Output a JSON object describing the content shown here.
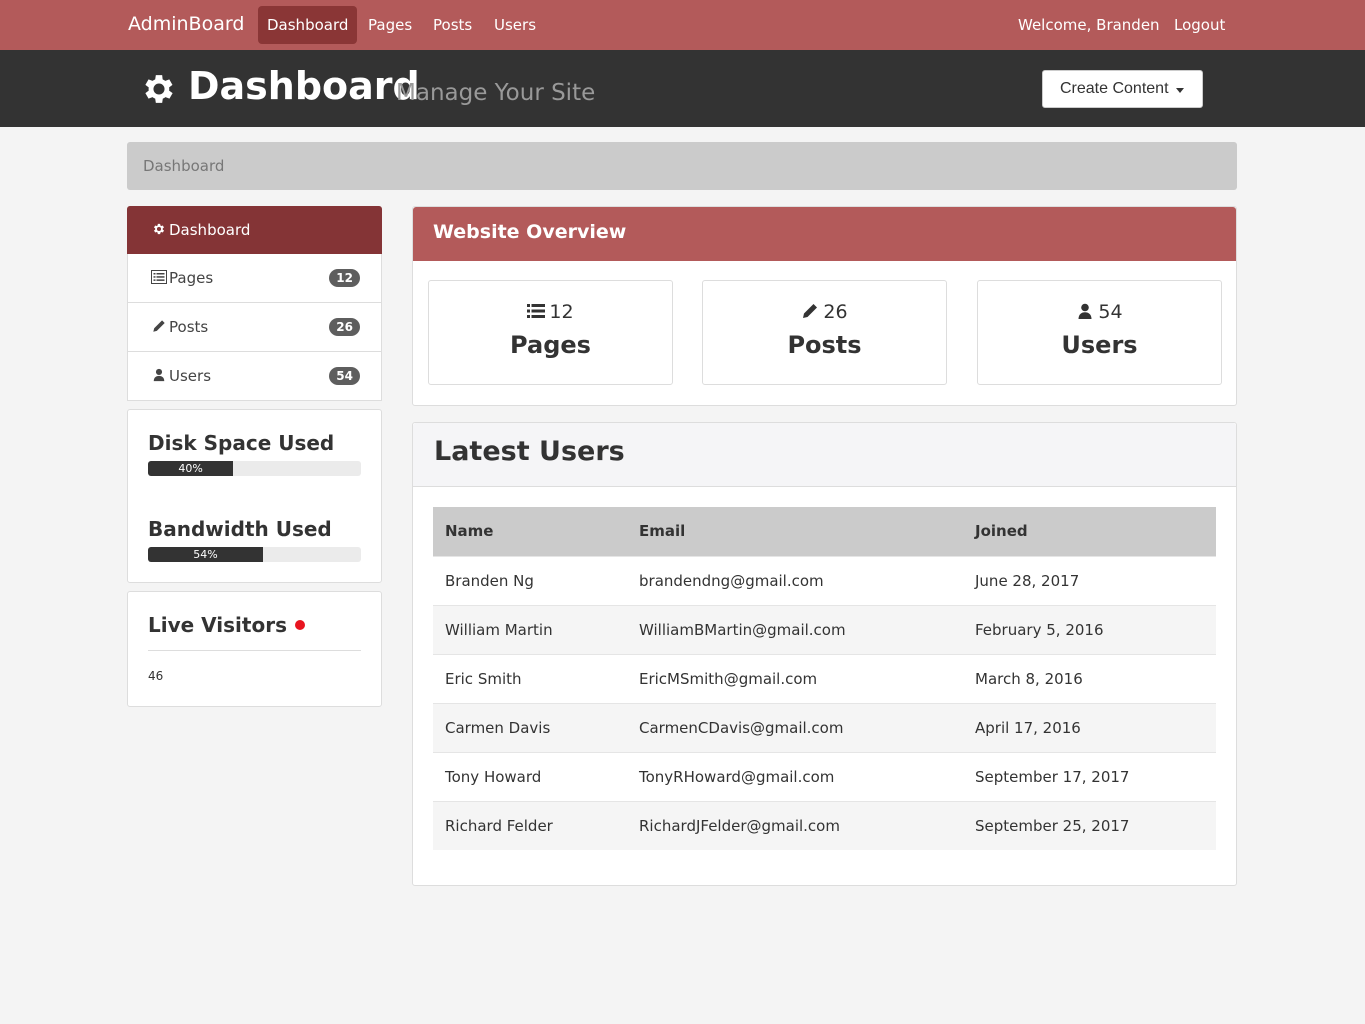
{
  "navbar": {
    "brand": "AdminBoard",
    "links": [
      "Dashboard",
      "Pages",
      "Posts",
      "Users"
    ],
    "welcome": "Welcome, Branden",
    "logout": "Logout"
  },
  "header": {
    "title": "Dashboard",
    "subtitle": "Manage Your Site",
    "create_button": "Create Content"
  },
  "breadcrumb": "Dashboard",
  "sidebar": {
    "items": [
      {
        "label": "Dashboard",
        "icon": "gear-icon"
      },
      {
        "label": "Pages",
        "icon": "list-icon",
        "count": "12"
      },
      {
        "label": "Posts",
        "icon": "pencil-icon",
        "count": "26"
      },
      {
        "label": "Users",
        "icon": "user-icon",
        "count": "54"
      }
    ],
    "disk": {
      "title": "Disk Space Used",
      "percent_label": "40%",
      "value": 0.4
    },
    "bandwidth": {
      "title": "Bandwidth Used",
      "percent_label": "54%",
      "value": 0.54
    },
    "live": {
      "title": "Live Visitors",
      "count": "46"
    }
  },
  "overview": {
    "title": "Website Overview",
    "stats": [
      {
        "number": "12",
        "label": "Pages",
        "icon": "list-icon"
      },
      {
        "number": "26",
        "label": "Posts",
        "icon": "pencil-icon"
      },
      {
        "number": "54",
        "label": "Users",
        "icon": "user-icon"
      }
    ]
  },
  "latest": {
    "title": "Latest Users",
    "columns": [
      "Name",
      "Email",
      "Joined"
    ],
    "rows": [
      [
        "Branden Ng",
        "brandendng@gmail.com",
        "June 28, 2017"
      ],
      [
        "William Martin",
        "WilliamBMartin@gmail.com",
        "February 5, 2016"
      ],
      [
        "Eric Smith",
        "EricMSmith@gmail.com",
        "March 8, 2016"
      ],
      [
        "Carmen Davis",
        "CarmenCDavis@gmail.com",
        "April 17, 2016"
      ],
      [
        "Tony Howard",
        "TonyRHoward@gmail.com",
        "September 17, 2017"
      ],
      [
        "Richard Felder",
        "RichardJFelder@gmail.com",
        "September 25, 2017"
      ]
    ]
  },
  "colors": {
    "brand": "#b35a5a",
    "active": "#843436",
    "header": "#333333",
    "live_dot": "#e8141f"
  }
}
